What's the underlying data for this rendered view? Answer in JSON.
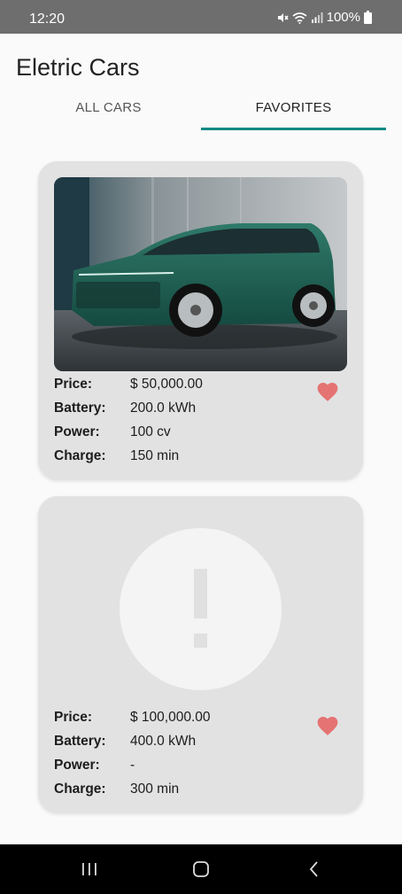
{
  "status_bar": {
    "time": "12:20",
    "battery": "100%"
  },
  "app": {
    "title": "Eletric Cars"
  },
  "tabs": [
    {
      "label": "ALL CARS",
      "selected": false
    },
    {
      "label": "FAVORITES",
      "selected": true
    }
  ],
  "cars": [
    {
      "image": "green-suv-photo",
      "price_label": "Price:",
      "price": "$ 50,000.00",
      "battery_label": "Battery:",
      "battery": "200.0 kWh",
      "power_label": "Power:",
      "power": "100 cv",
      "charge_label": "Charge:",
      "charge": "150 min",
      "favorite": true
    },
    {
      "image": "placeholder-exclamation",
      "price_label": "Price:",
      "price": "$ 100,000.00",
      "battery_label": "Battery:",
      "battery": "400.0 kWh",
      "power_label": "Power:",
      "power": "-",
      "charge_label": "Charge:",
      "charge": "300 min",
      "favorite": true
    }
  ],
  "colors": {
    "accent": "#0f8a84",
    "heart": "#e57373",
    "card": "#e2e2e2",
    "status_bar": "#6e6e6e"
  },
  "nav_bar": {
    "icons": [
      "recent-apps-icon",
      "home-icon",
      "back-icon"
    ]
  }
}
